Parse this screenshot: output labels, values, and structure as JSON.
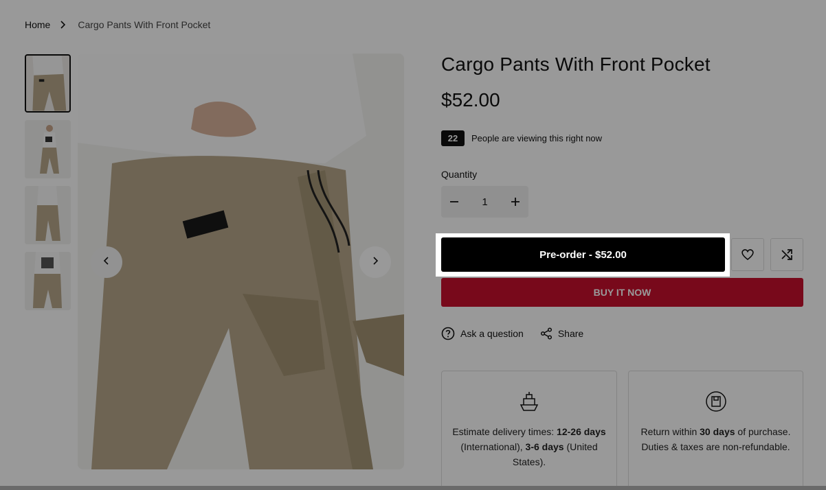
{
  "breadcrumb": {
    "home": "Home",
    "current": "Cargo Pants With Front Pocket"
  },
  "product": {
    "title": "Cargo Pants With Front Pocket",
    "price": "$52.00",
    "viewers_count": "22",
    "viewers_text": "People are viewing this right now",
    "quantity_label": "Quantity",
    "quantity_value": "1",
    "preorder_label": "Pre-order - $52.00",
    "buy_now_label": "BUY IT NOW",
    "ask_label": "Ask a question",
    "share_label": "Share"
  },
  "delivery": {
    "text_a": "Estimate delivery times: ",
    "bold_a": "12-26 days",
    "text_b": " (International), ",
    "bold_b": "3-6 days",
    "text_c": " (United States)."
  },
  "returns": {
    "text_a": "Return within ",
    "bold_a": "30 days",
    "text_b": " of purchase. Duties & taxes are non-refundable."
  },
  "colors": {
    "buy_now": "#c8102e",
    "preorder": "#000000",
    "pants": "#b7a78a"
  },
  "icons": [
    "chevron-right-icon",
    "chevron-left-icon",
    "minus-icon",
    "plus-icon",
    "heart-icon",
    "shuffle-icon",
    "question-icon",
    "share-icon",
    "ship-icon",
    "return-box-icon"
  ]
}
